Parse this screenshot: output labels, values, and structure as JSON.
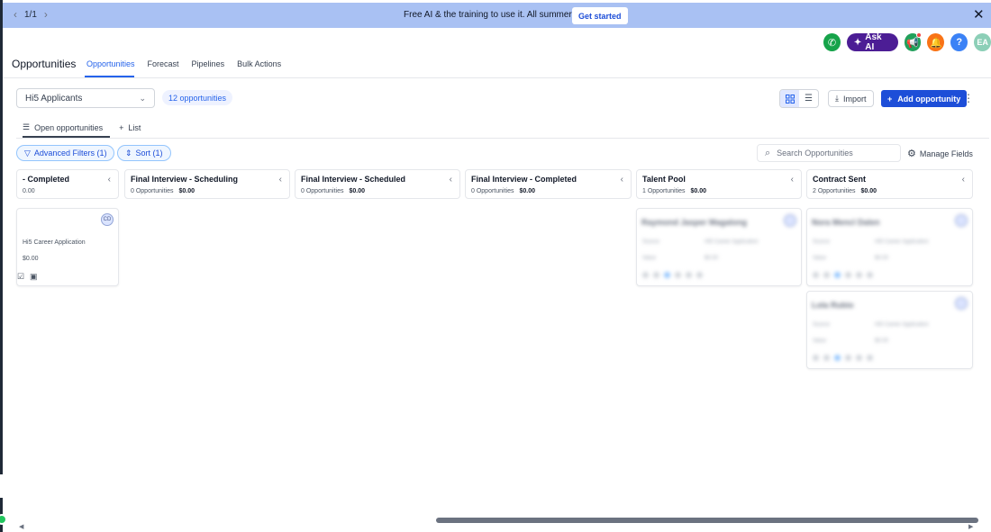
{
  "banner": {
    "pager": "1/1",
    "message": "Free AI & the training to use it. All summer long.",
    "cta": "Get started"
  },
  "header": {
    "ask_ai": "Ask AI",
    "avatar_initials": "EA",
    "help": "?"
  },
  "page": {
    "title": "Opportunities",
    "tabs": [
      {
        "label": "Opportunities",
        "active": true
      },
      {
        "label": "Forecast"
      },
      {
        "label": "Pipelines"
      },
      {
        "label": "Bulk Actions"
      }
    ]
  },
  "toolbar": {
    "pipeline": "Hi5 Applicants",
    "count": "12 opportunities",
    "import": "Import",
    "add": "Add opportunity"
  },
  "subtabs": {
    "open": "Open opportunities",
    "list": "List"
  },
  "filters": {
    "advanced": "Advanced Filters (1)",
    "sort": "Sort (1)",
    "search_placeholder": "Search Opportunities",
    "manage_fields": "Manage Fields"
  },
  "columns": [
    {
      "title": "- Completed",
      "count": "",
      "amount": "0.00"
    },
    {
      "title": "Final Interview - Scheduling",
      "count": "0 Opportunities",
      "amount": "$0.00"
    },
    {
      "title": "Final Interview - Scheduled",
      "count": "0 Opportunities",
      "amount": "$0.00"
    },
    {
      "title": "Final Interview - Completed",
      "count": "0 Opportunities",
      "amount": "$0.00"
    },
    {
      "title": "Talent Pool",
      "count": "1 Opportunities",
      "amount": "$0.00"
    },
    {
      "title": "Contract Sent",
      "count": "2 Opportunities",
      "amount": "$0.00"
    }
  ],
  "cards": {
    "first": {
      "initials": "CD",
      "source": "Hi5 Career Application",
      "value": "$0.00"
    },
    "talent": {
      "name": "Raymond Jasper Magalong"
    },
    "contract1": {
      "name": "Nora Mencl Dalen"
    },
    "contract2": {
      "name": "Lola Rubio"
    }
  }
}
